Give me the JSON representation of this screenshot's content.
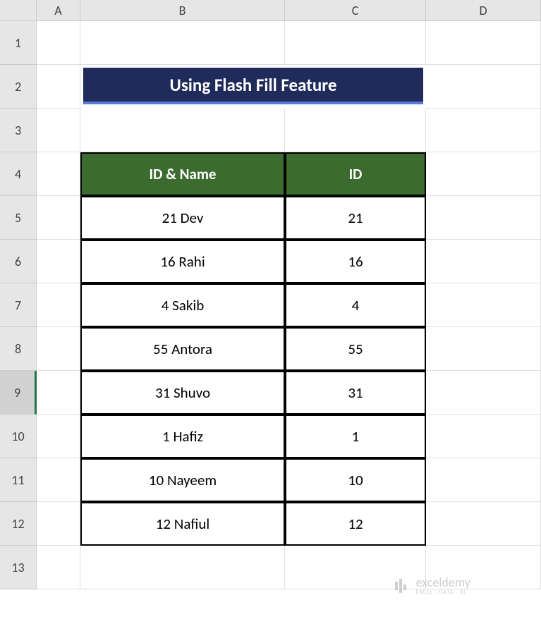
{
  "columns": [
    "",
    "A",
    "B",
    "C",
    "D"
  ],
  "rows": [
    "1",
    "2",
    "3",
    "4",
    "5",
    "6",
    "7",
    "8",
    "9",
    "10",
    "11",
    "12",
    "13"
  ],
  "selected_row": 9,
  "title": "Using Flash Fill Feature",
  "table": {
    "headers": {
      "b": "ID & Name",
      "c": "ID"
    },
    "rows": [
      {
        "b": "21 Dev",
        "c": "21"
      },
      {
        "b": "16 Rahi",
        "c": "16"
      },
      {
        "b": "4 Sakib",
        "c": "4"
      },
      {
        "b": "55 Antora",
        "c": "55"
      },
      {
        "b": "31 Shuvo",
        "c": "31"
      },
      {
        "b": "1 Hafiz",
        "c": "1"
      },
      {
        "b": "10 Nayeem",
        "c": "10"
      },
      {
        "b": "12 Nafiul",
        "c": "12"
      }
    ]
  },
  "watermark": {
    "name": "exceldemy",
    "sub": "EXCEL · DATA · BI"
  }
}
